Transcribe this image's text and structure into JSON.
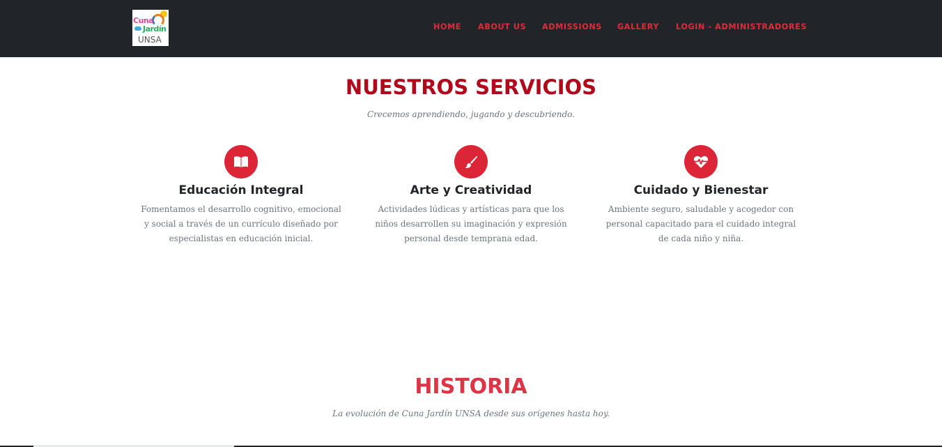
{
  "header": {
    "logo": {
      "line1": "Cuna",
      "line2": "Jardín",
      "line3": "UNSA"
    },
    "nav": [
      {
        "label": "HOME"
      },
      {
        "label": "ABOUT US"
      },
      {
        "label": "ADMISSIONS"
      },
      {
        "label": "GALLERY"
      },
      {
        "label": "LOGIN - ADMINISTRADORES"
      }
    ]
  },
  "services": {
    "title": "NUESTROS SERVICIOS",
    "subtitle": "Crecemos aprendiendo, jugando y descubriendo.",
    "items": [
      {
        "icon": "book-open-icon",
        "title": "Educación Integral",
        "text": "Fomentamos el desarrollo cognitivo, emocional y social a través de un currículo diseñado por especialistas en educación inicial."
      },
      {
        "icon": "paint-brush-icon",
        "title": "Arte y Creatividad",
        "text": "Actividades lúdicas y artísticas para que los niños desarrollen su imaginación y expresión personal desde temprana edad."
      },
      {
        "icon": "heartbeat-icon",
        "title": "Cuidado y Bienestar",
        "text": "Ambiente seguro, saludable y acogedor con personal capacitado para el cuidado integral de cada niño y niña."
      }
    ]
  },
  "history": {
    "title": "HISTORIA",
    "subtitle": "La evolución de Cuna Jardín UNSA desde sus orígenes hasta hoy."
  },
  "colors": {
    "navbar_bg": "#212529",
    "accent": "#dc2638",
    "services_title": "#b0091c",
    "history_title": "#dc3545"
  }
}
